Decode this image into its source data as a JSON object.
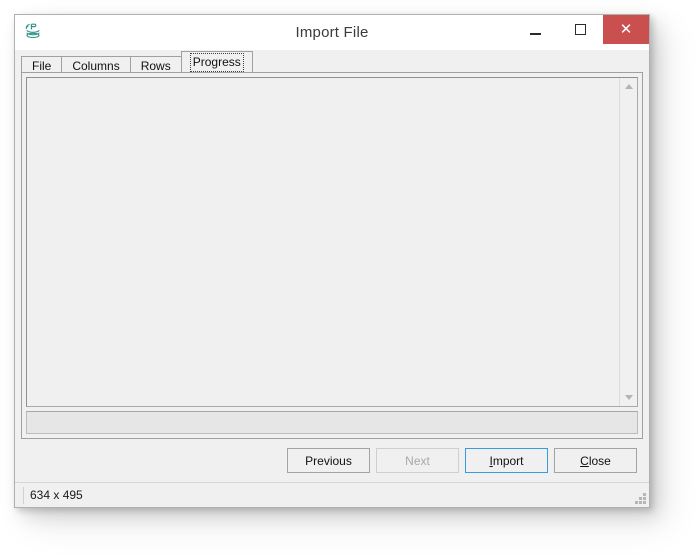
{
  "window": {
    "title": "Import File",
    "icon": "database-p-icon",
    "controls": {
      "minimize_label": "–",
      "maximize_label": "□",
      "close_label": "✕"
    }
  },
  "tabs": [
    {
      "label": "File",
      "selected": false
    },
    {
      "label": "Columns",
      "selected": false
    },
    {
      "label": "Rows",
      "selected": false
    },
    {
      "label": "Progress",
      "selected": true
    }
  ],
  "progress_page": {
    "log_entries": [],
    "progress_percent": 0,
    "scrollbar": {
      "up_arrow": "▲",
      "down_arrow": "▼"
    }
  },
  "buttons": {
    "previous": {
      "label": "Previous",
      "enabled": true,
      "default": false
    },
    "next": {
      "label": "Next",
      "enabled": false,
      "default": false
    },
    "import": {
      "label": "Import",
      "accel": "I",
      "enabled": true,
      "default": true
    },
    "close": {
      "label": "Close",
      "accel": "C",
      "enabled": true,
      "default": false
    }
  },
  "statusbar": {
    "size_text": "634 x 495",
    "grip": "resize-grip"
  },
  "colors": {
    "close_button": "#c9504f",
    "default_button_border": "#3a9bdc",
    "window_background": "#f0f0f0",
    "titlebar_background": "#ffffff",
    "icon_accent": "#2f9189"
  }
}
